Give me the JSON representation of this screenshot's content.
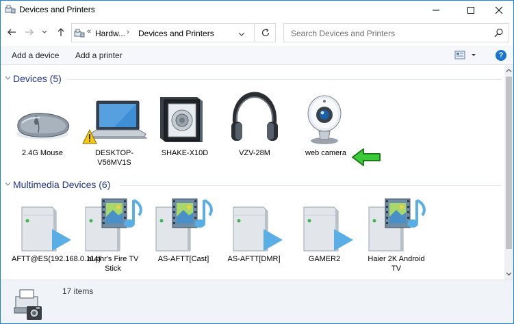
{
  "window": {
    "title": "Devices and Printers",
    "minimize_icon": "minimize-icon",
    "maximize_icon": "maximize-icon",
    "close_icon": "close-icon"
  },
  "nav": {
    "breadcrumb": [
      "Hardw...",
      "Devices and Printers"
    ],
    "breadcrumb_prefix": "«",
    "search_placeholder": "Search Devices and Printers"
  },
  "commands": {
    "add_device": "Add a device",
    "add_printer": "Add a printer",
    "help": "?"
  },
  "groups": [
    {
      "title": "Devices (5)",
      "items": [
        {
          "label": "2.4G Mouse",
          "icon": "mouse-icon"
        },
        {
          "label": "DESKTOP-V56MV1S",
          "icon": "laptop-warning-icon"
        },
        {
          "label": "SHAKE-X10D",
          "icon": "speaker-icon"
        },
        {
          "label": "VZV-28M",
          "icon": "headphones-icon"
        },
        {
          "label": "web camera",
          "icon": "webcam-icon"
        }
      ]
    },
    {
      "title": "Multimedia Devices (6)",
      "items": [
        {
          "label": "AFTT@ES(192.168.0.114)",
          "icon": "media-server-play-icon"
        },
        {
          "label": "aLphr's Fire TV Stick",
          "icon": "media-renderer-icon"
        },
        {
          "label": "AS-AFTT[Cast]",
          "icon": "media-renderer-icon"
        },
        {
          "label": "AS-AFTT[DMR]",
          "icon": "media-server-play-icon"
        },
        {
          "label": "GAMER2",
          "icon": "media-server-play-icon"
        },
        {
          "label": "Haier 2K Android TV",
          "icon": "media-renderer-icon"
        }
      ]
    }
  ],
  "details": {
    "count": "17 items"
  },
  "colors": {
    "group_title": "#1e3287",
    "accent": "#1874d1",
    "arrow_green": "#3cc93a"
  }
}
